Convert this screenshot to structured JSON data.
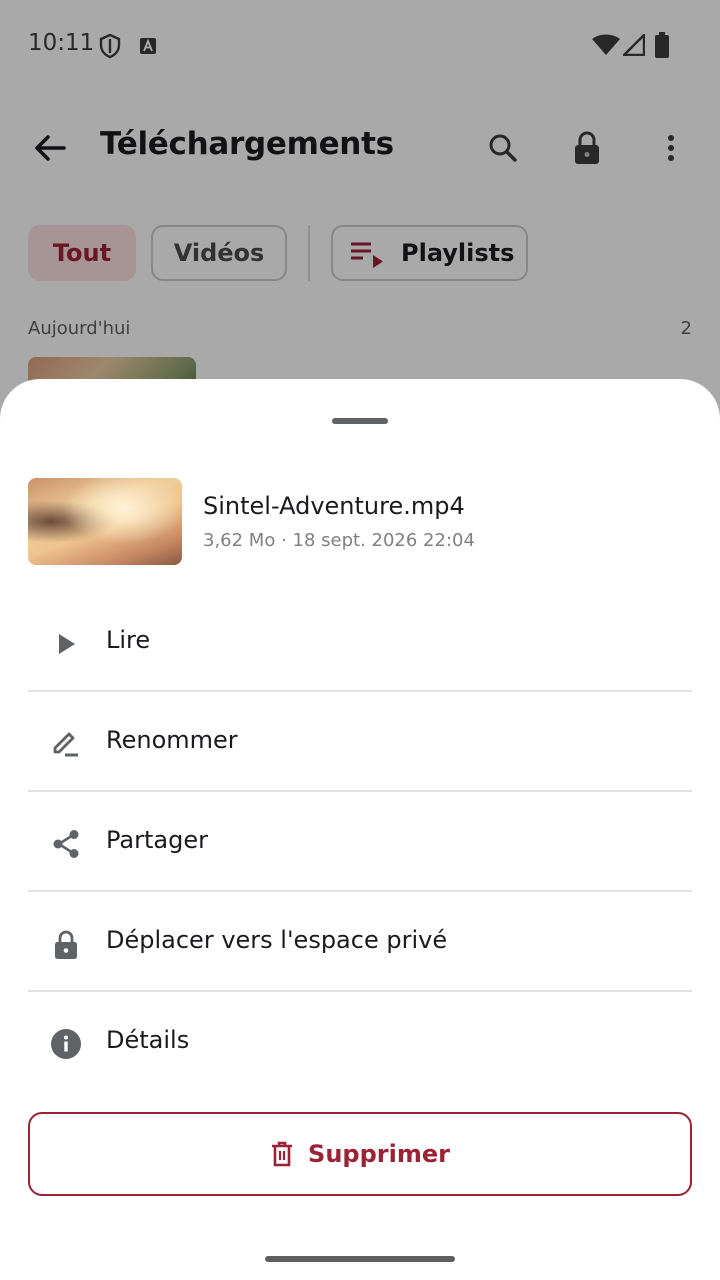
{
  "status_bar": {
    "time": "10:11"
  },
  "app_bar": {
    "title": "Téléchargements"
  },
  "filters": {
    "all": "Tout",
    "videos": "Vidéos",
    "playlists": "Playlists"
  },
  "section": {
    "label": "Aujourd'hui",
    "count": "2"
  },
  "sheet": {
    "file_name": "Sintel-Adventure.mp4",
    "file_meta": "3,62 Mo · 18 sept. 2026 22:04",
    "menu": [
      {
        "label": "Lire",
        "icon": "play-icon"
      },
      {
        "label": "Renommer",
        "icon": "edit-icon"
      },
      {
        "label": "Partager",
        "icon": "share-icon"
      },
      {
        "label": "Déplacer vers l'espace privé",
        "icon": "lock-icon"
      },
      {
        "label": "Détails",
        "icon": "info-icon"
      }
    ],
    "delete_label": "Supprimer"
  },
  "colors": {
    "accent": "#9b2335",
    "chip_selected_bg": "#f7dcdc",
    "icon_gray": "#5f6366"
  }
}
